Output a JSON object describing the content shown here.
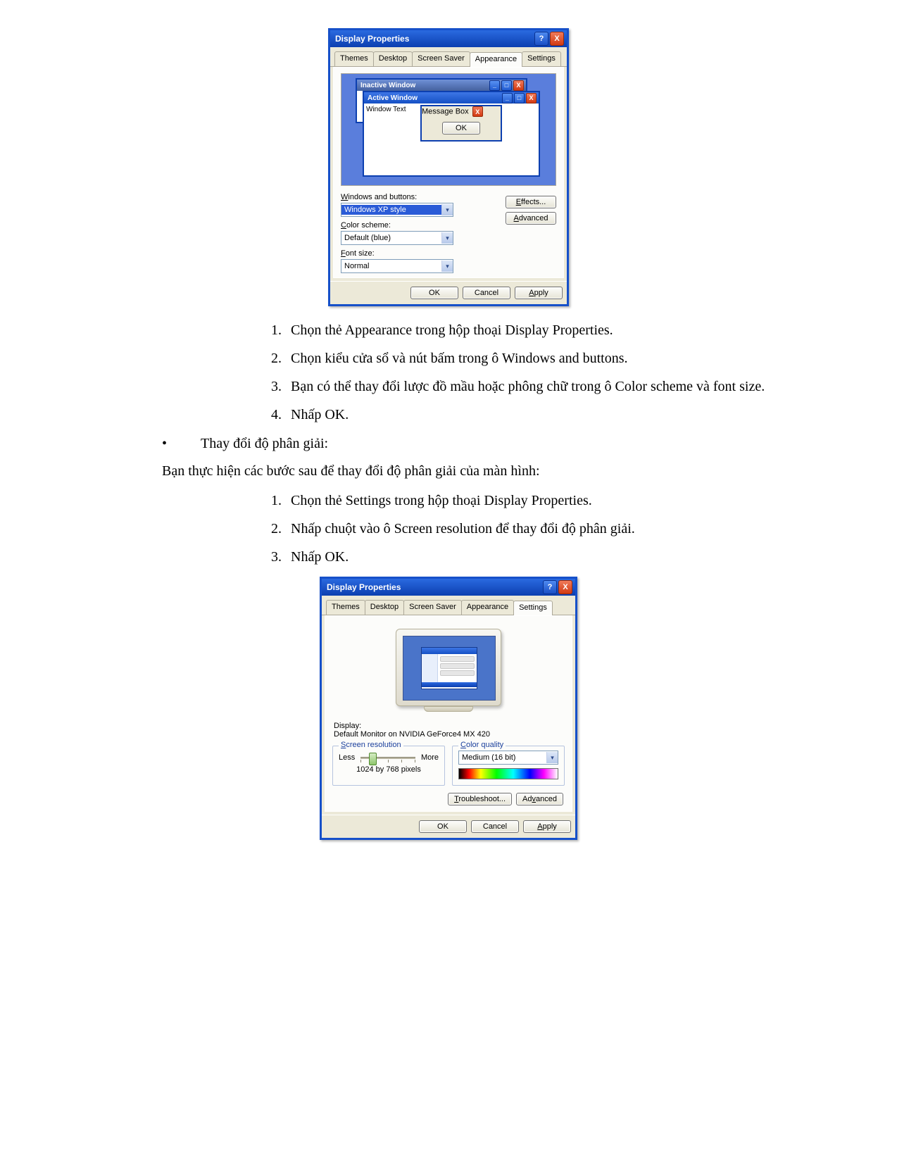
{
  "dlg1": {
    "title": "Display Properties",
    "tabs": [
      "Themes",
      "Desktop",
      "Screen Saver",
      "Appearance",
      "Settings"
    ],
    "active_tab": "Appearance",
    "preview": {
      "inactive_title": "Inactive Window",
      "active_title": "Active Window",
      "window_text": "Window Text",
      "msgbox_title": "Message Box",
      "msgbox_ok": "OK"
    },
    "labels": {
      "winbtn": "Windows and buttons:",
      "color": "Color scheme:",
      "font": "Font size:"
    },
    "values": {
      "winbtn": "Windows XP style",
      "color": "Default (blue)",
      "font": "Normal"
    },
    "side_buttons": {
      "effects": "Effects...",
      "advanced": "Advanced"
    },
    "footer": {
      "ok": "OK",
      "cancel": "Cancel",
      "apply": "Apply"
    }
  },
  "steps_a": [
    "Chọn thẻ  Appearance trong hộp thoại Display Properties.",
    "Chọn kiểu cửa sổ và nút bấm trong ô Windows and buttons.",
    "Bạn có thể thay đổi lược đồ mầu hoặc phông chữ trong ô Color scheme và font size.",
    "Nhấp OK."
  ],
  "bullet": "Thay đổi độ phân giải:",
  "intro_b": "Bạn thực hiện các bước sau để thay đổi độ phân giải của màn hình:",
  "steps_b": [
    "Chọn thẻ  Settings trong hộp thoại Display Properties.",
    "Nhấp chuột vào ô Screen resolution để thay đổi độ phân giải.",
    "Nhấp OK."
  ],
  "dlg2": {
    "title": "Display Properties",
    "tabs": [
      "Themes",
      "Desktop",
      "Screen Saver",
      "Appearance",
      "Settings"
    ],
    "active_tab": "Settings",
    "display_label": "Display:",
    "display_value": "Default Monitor on NVIDIA GeForce4 MX 420",
    "group_res": "Screen resolution",
    "res_less": "Less",
    "res_more": "More",
    "res_value": "1024 by 768 pixels",
    "group_cq": "Color quality",
    "cq_value": "Medium (16 bit)",
    "btn_troubleshoot": "Troubleshoot...",
    "btn_advanced": "Advanced",
    "footer": {
      "ok": "OK",
      "cancel": "Cancel",
      "apply": "Apply"
    }
  }
}
